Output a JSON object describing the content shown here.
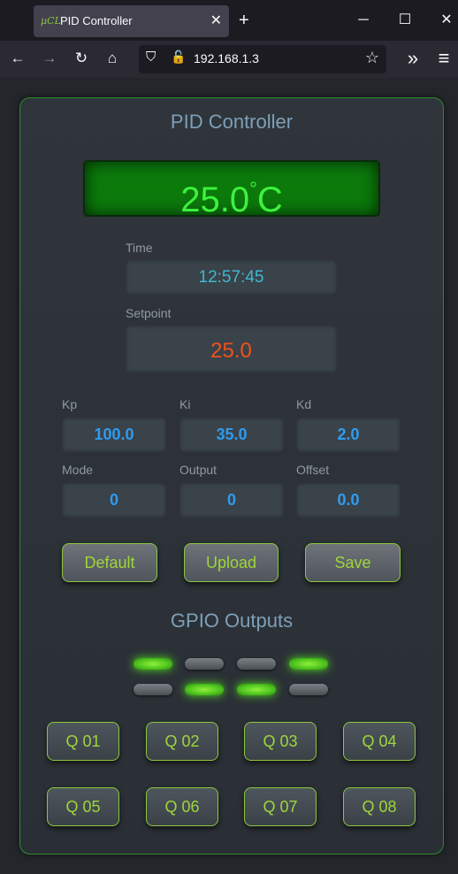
{
  "browser": {
    "tab_title": "PID Controller",
    "tab_favicon": "µCL",
    "tab_close": "✕",
    "new_tab": "+",
    "url": "192.168.1.3",
    "window_minimize": "─",
    "window_maximize": "☐",
    "window_close": "✕"
  },
  "toolbar": {
    "back": "←",
    "forward": "→",
    "reload": "↻",
    "home": "⌂",
    "bookmark": "☆",
    "overflow": "»",
    "menu": "≡",
    "shield": "⛉",
    "lock": "🔓"
  },
  "header": {
    "title": "PID Controller"
  },
  "display": {
    "temperature": "25.0",
    "degree": "°",
    "unit": "C"
  },
  "time": {
    "label": "Time",
    "value": "12:57:45"
  },
  "setpoint": {
    "label": "Setpoint",
    "value": "25.0"
  },
  "params": {
    "kp": {
      "label": "Kp",
      "value": "100.0"
    },
    "ki": {
      "label": "Ki",
      "value": "35.0"
    },
    "kd": {
      "label": "Kd",
      "value": "2.0"
    },
    "mode": {
      "label": "Mode",
      "value": "0"
    },
    "output": {
      "label": "Output",
      "value": "0"
    },
    "offset": {
      "label": "Offset",
      "value": "0.0"
    }
  },
  "actions": {
    "default": "Default",
    "upload": "Upload",
    "save": "Save"
  },
  "gpio": {
    "title": "GPIO Outputs",
    "leds": [
      true,
      false,
      false,
      true,
      false,
      true,
      true,
      false
    ],
    "buttons": [
      "Q 01",
      "Q 02",
      "Q 03",
      "Q 04",
      "Q 05",
      "Q 06",
      "Q 07",
      "Q 08"
    ]
  },
  "colors": {
    "accent": "#8dc63f",
    "lcd": "#0b7a0b",
    "lcd_text": "#3df23d",
    "setpoint": "#f0521a",
    "param": "#2e9cf0",
    "time": "#3fb8cf"
  }
}
